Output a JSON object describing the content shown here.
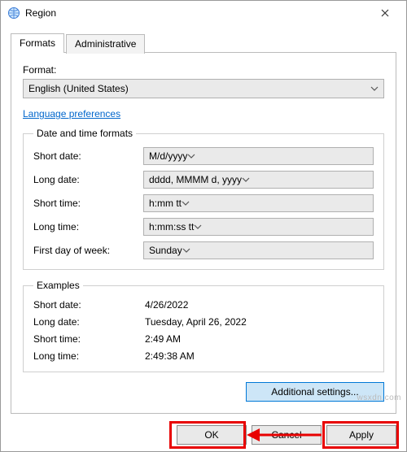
{
  "window": {
    "title": "Region"
  },
  "tabs": {
    "formats": "Formats",
    "administrative": "Administrative"
  },
  "format": {
    "label": "Format:",
    "value": "English (United States)"
  },
  "link": {
    "language_preferences": "Language preferences"
  },
  "dtf": {
    "legend": "Date and time formats",
    "short_date_label": "Short date:",
    "short_date_value": "M/d/yyyy",
    "long_date_label": "Long date:",
    "long_date_value": "dddd, MMMM d, yyyy",
    "short_time_label": "Short time:",
    "short_time_value": "h:mm tt",
    "long_time_label": "Long time:",
    "long_time_value": "h:mm:ss tt",
    "first_day_label": "First day of week:",
    "first_day_value": "Sunday"
  },
  "examples": {
    "legend": "Examples",
    "short_date_label": "Short date:",
    "short_date_value": "4/26/2022",
    "long_date_label": "Long date:",
    "long_date_value": "Tuesday, April 26, 2022",
    "short_time_label": "Short time:",
    "short_time_value": "2:49 AM",
    "long_time_label": "Long time:",
    "long_time_value": "2:49:38 AM"
  },
  "buttons": {
    "additional_settings": "Additional settings...",
    "ok": "OK",
    "cancel": "Cancel",
    "apply": "Apply"
  },
  "watermark": "wsxdn.com"
}
